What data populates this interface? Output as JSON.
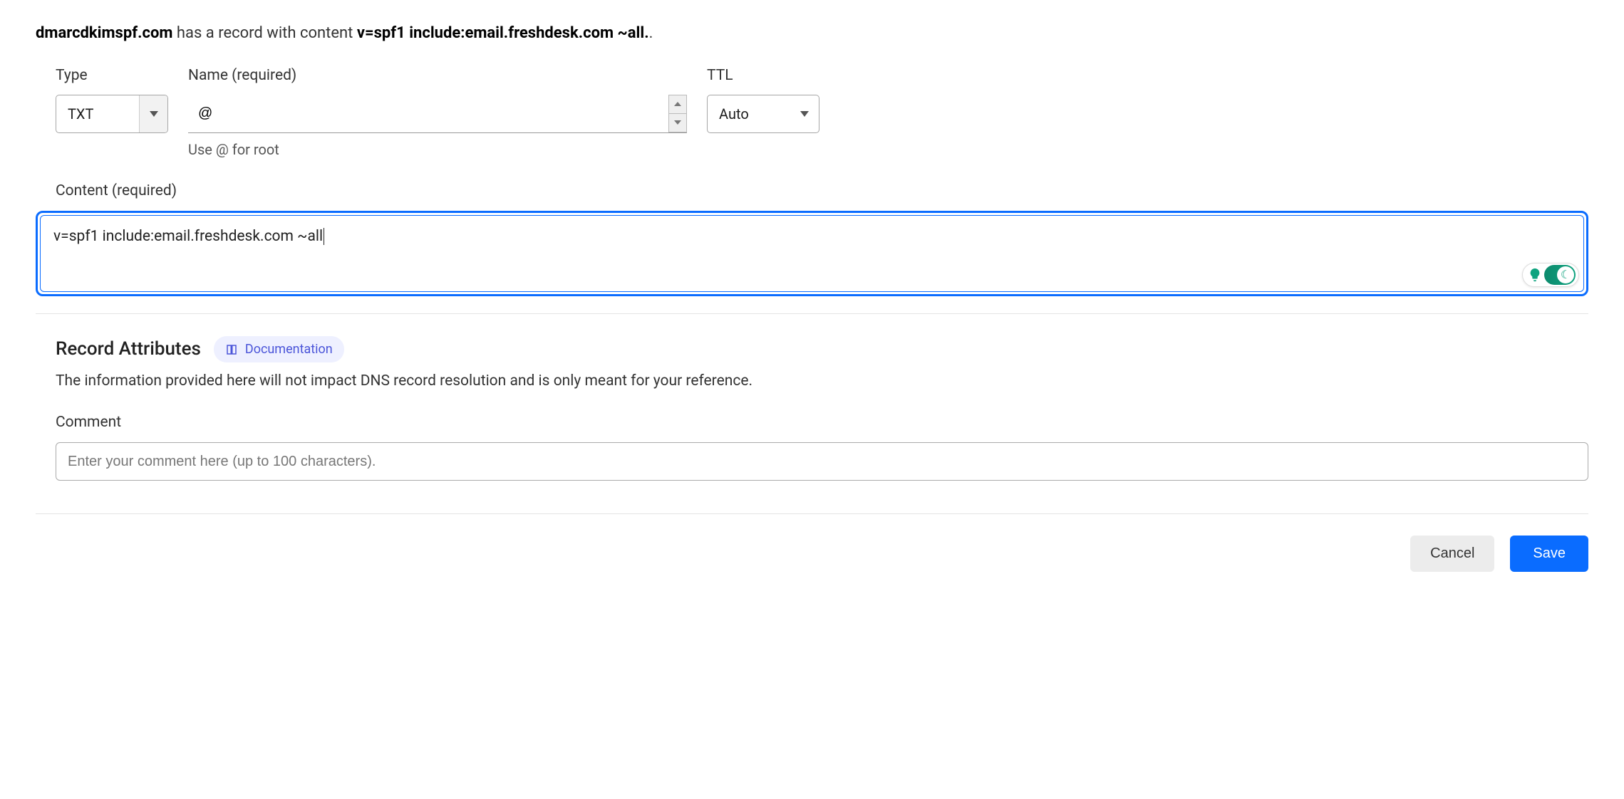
{
  "header": {
    "domain": "dmarcdkimspf.com",
    "middle": " has a record with content ",
    "record": "v=spf1 include:email.freshdesk.com ~all.",
    "tail": "."
  },
  "fields": {
    "type": {
      "label": "Type",
      "value": "TXT"
    },
    "name": {
      "label": "Name (required)",
      "value": "@",
      "hint": "Use @ for root"
    },
    "ttl": {
      "label": "TTL",
      "value": "Auto"
    },
    "content": {
      "label": "Content (required)",
      "value": "v=spf1 include:email.freshdesk.com ~all"
    }
  },
  "attributes": {
    "title": "Record Attributes",
    "doc_label": "Documentation",
    "description": "The information provided here will not impact DNS record resolution and is only meant for your reference."
  },
  "comment": {
    "label": "Comment",
    "placeholder": "Enter your comment here (up to 100 characters)."
  },
  "buttons": {
    "cancel": "Cancel",
    "save": "Save"
  }
}
